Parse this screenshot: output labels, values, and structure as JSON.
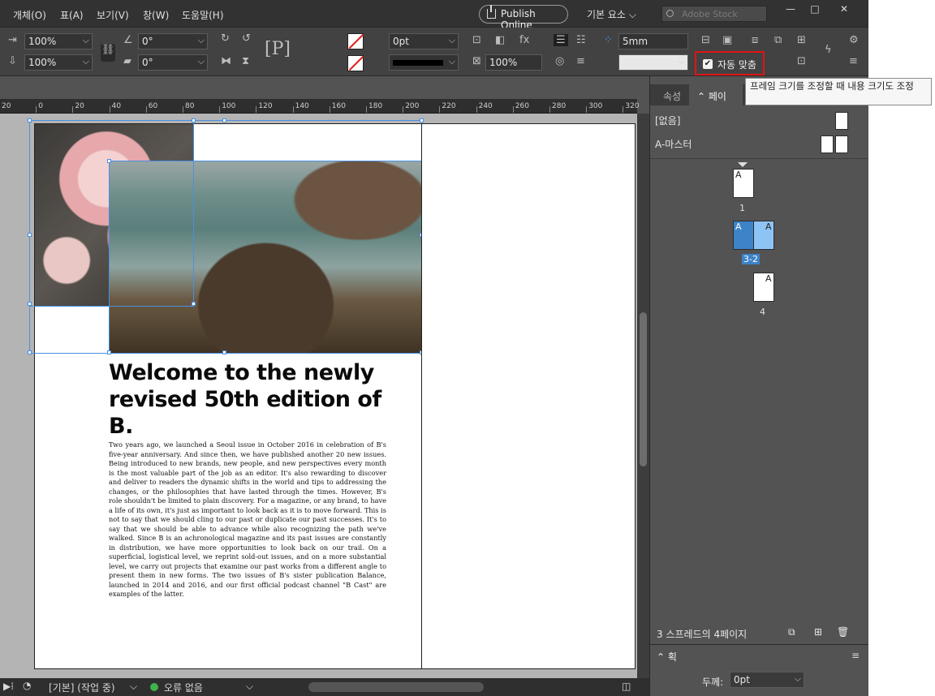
{
  "menubar": {
    "items": [
      "개체(O)",
      "표(A)",
      "보기(V)",
      "창(W)",
      "도움말(H)"
    ],
    "publish": "Publish Online",
    "workspace": "기본 요소",
    "stock_placeholder": "Adobe Stock"
  },
  "toolbar": {
    "scale_x": "100%",
    "scale_y": "100%",
    "rotate": "0°",
    "shear": "0°",
    "stroke_weight": "0pt",
    "opacity": "100%",
    "gap": "5mm",
    "autofit_label": "자동 맞춤"
  },
  "ruler": {
    "labels": [
      "20",
      "0",
      "20",
      "40",
      "60",
      "80",
      "100",
      "120",
      "140",
      "160",
      "180",
      "200",
      "220",
      "240",
      "260",
      "280",
      "300",
      "320"
    ]
  },
  "doc": {
    "headline_l1": "Welcome to the newly",
    "headline_l2": "revised 50th edition of B.",
    "body": "Two years ago, we launched a Seoul issue in October 2016 in celebration of B's five-year anniversary. And since then, we have published another 20 new issues. Being introduced to new brands, new people, and new perspectives every month is the most valuable part of the job as an editor. It's also rewarding to discover and deliver to readers the dynamic shifts in the world and tips to addressing the changes, or the philosophies that have lasted through the times. However, B's role shouldn't be limited to plain discovery. For a magazine, or any brand, to have a life of its own, it's just as important to look back as it is to move forward. This is not to say that we should cling to our past or duplicate our past successes. It's to say that we should be able to advance while also recognizing the path we've walked. Since B is an achronological magazine and its past issues are constantly in distribution, we have more opportunities to look back on our trail. On a superficial, logistical level, we reprint sold-out issues, and on a more substantial level, we carry out projects that examine our past works from a different angle to present them in new forms. The two issues of B's sister publication Balance, launched in 2014 and 2016, and our first official podcast channel \"B Cast\" are examples of the latter."
  },
  "status": {
    "preflight_profile": "[기본] (작업 중)",
    "errors": "오류 없음"
  },
  "panel": {
    "tab_properties": "속성",
    "tab_pages": "페이지",
    "none_master": "[없음]",
    "a_master": "A-마스터",
    "page1": "1",
    "spread": "3-2",
    "page4": "4",
    "master_letter": "A",
    "summary": "3 스프레드의 4페이지",
    "stroke_title": "획",
    "stroke_weight_label": "두께:",
    "stroke_weight": "0pt"
  },
  "tooltip": {
    "text": "프레임 크기를 조정할 때 내용 크기도 조정"
  }
}
